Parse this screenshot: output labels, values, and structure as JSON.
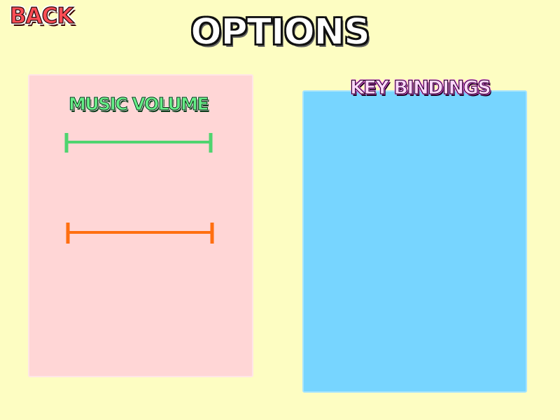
{
  "header": {
    "back_label": "BACK",
    "title": "OPTIONS"
  },
  "volume_panel": {
    "heading": "MUSIC VOLUME",
    "sliders": [
      {
        "color": "#4fd46f"
      },
      {
        "color": "#ff6f10"
      }
    ]
  },
  "bindings_panel": {
    "heading": "KEY BINDINGS"
  },
  "colors": {
    "background": "#fdfdc2",
    "volume_panel": "#ffd6d6",
    "bindings_panel": "#77d5ff"
  }
}
